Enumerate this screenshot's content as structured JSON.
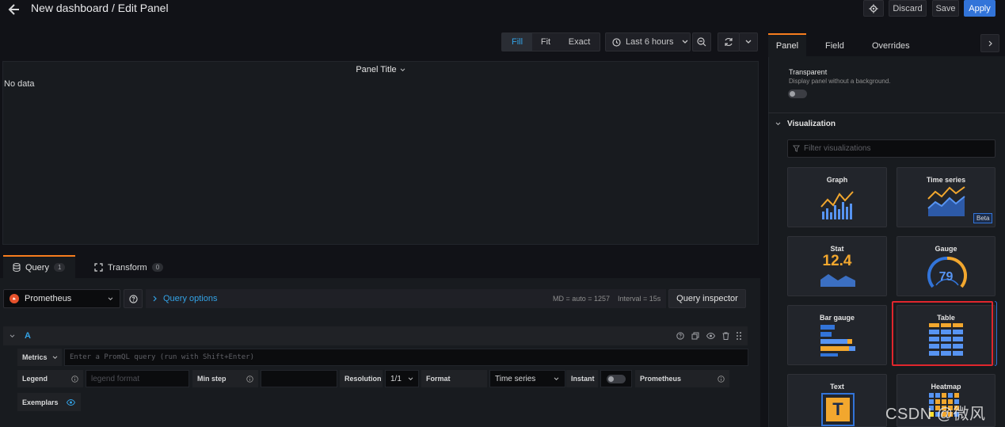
{
  "header": {
    "title": "New dashboard / Edit Panel",
    "discard_label": "Discard",
    "save_label": "Save",
    "apply_label": "Apply"
  },
  "toolbar": {
    "fill_label": "Fill",
    "fit_label": "Fit",
    "exact_label": "Exact",
    "time_range": "Last 6 hours"
  },
  "preview": {
    "panel_title": "Panel Title",
    "no_data": "No data"
  },
  "query_tabs": {
    "query_label": "Query",
    "query_count": "1",
    "transform_label": "Transform",
    "transform_count": "0"
  },
  "datasource": {
    "name": "Prometheus",
    "query_options_label": "Query options",
    "md_info": "MD = auto = 1257",
    "interval_info": "Interval = 15s",
    "inspector_label": "Query inspector"
  },
  "query_a": {
    "ref": "A",
    "metrics_label": "Metrics",
    "metrics_placeholder": "Enter a PromQL query (run with Shift+Enter)",
    "legend_label": "Legend",
    "legend_placeholder": "legend format",
    "min_step_label": "Min step",
    "resolution_label": "Resolution",
    "resolution_value": "1/1",
    "format_label": "Format",
    "format_value": "Time series",
    "instant_label": "Instant",
    "prometheus_label": "Prometheus",
    "exemplars_label": "Exemplars"
  },
  "side": {
    "tabs": [
      "Panel",
      "Field",
      "Overrides"
    ],
    "transparent_title": "Transparent",
    "transparent_desc": "Display panel without a background.",
    "viz_section": "Visualization",
    "filter_placeholder": "Filter visualizations",
    "viz": {
      "graph": "Graph",
      "time_series": "Time series",
      "beta": "Beta",
      "stat": "Stat",
      "stat_value": "12.4",
      "gauge": "Gauge",
      "gauge_value": "79",
      "bar_gauge": "Bar gauge",
      "table": "Table",
      "text": "Text",
      "text_glyph": "T",
      "heatmap": "Heatmap"
    }
  },
  "watermark": "CSDN @微风",
  "colors": {
    "accent_blue": "#3274d9",
    "orange": "#f2a72e",
    "yellow": "#fade2a",
    "highlight_red": "#e0262d"
  }
}
